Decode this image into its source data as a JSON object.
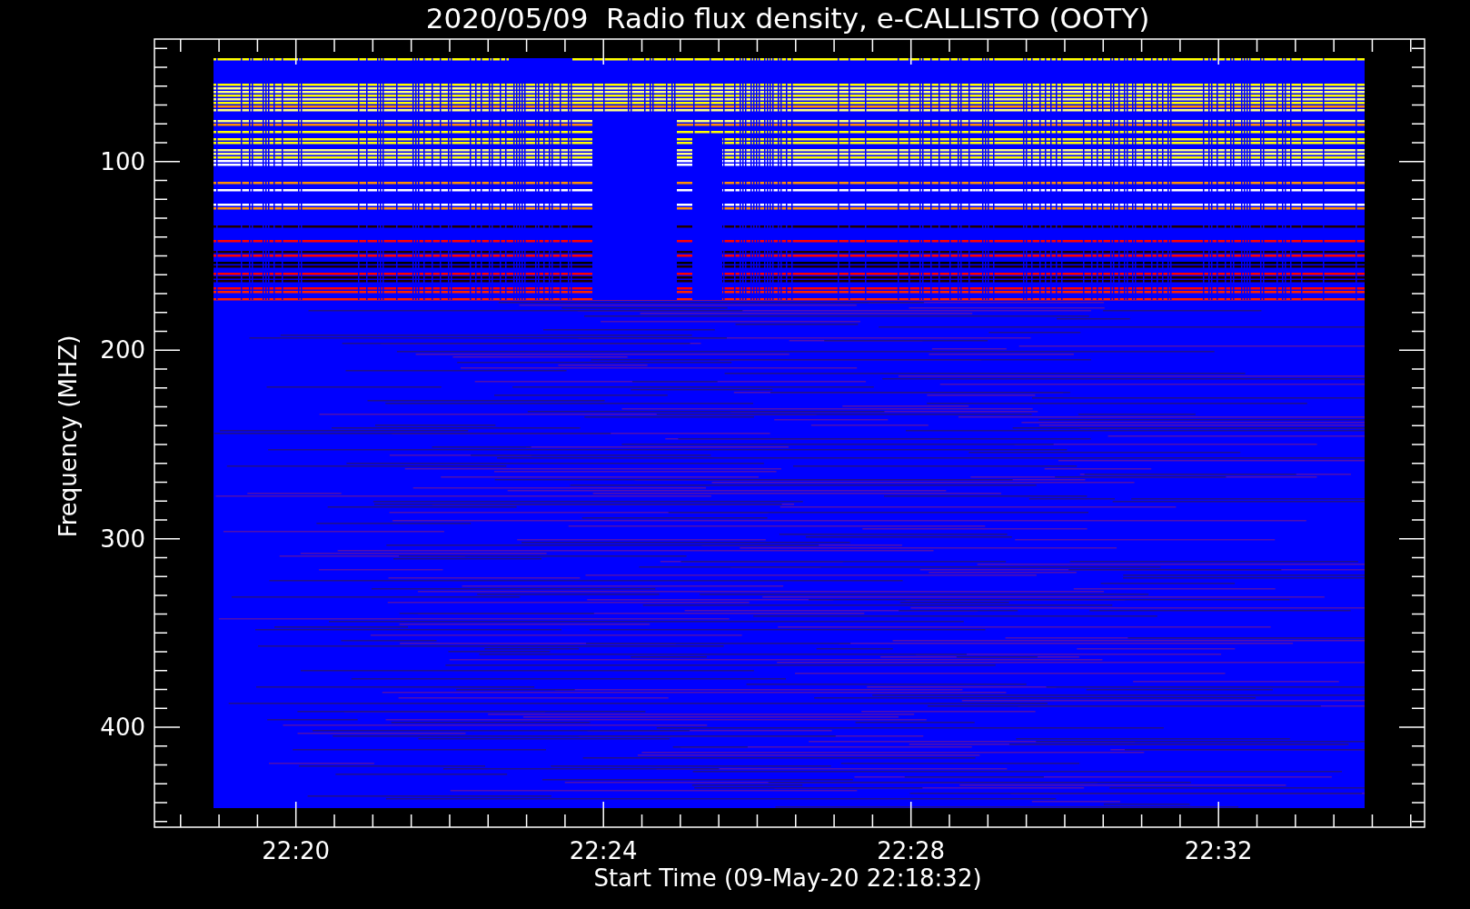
{
  "plot": {
    "title": "2020/05/09  Radio flux density, e-CALLISTO (OOTY)",
    "ylabel": "Frequency (MHZ)",
    "xlabel": "Start Time (09-May-20 22:18:32)",
    "yticks": [
      "100",
      "200",
      "300",
      "400"
    ],
    "xticks": [
      "22:20",
      "22:24",
      "22:28",
      "22:32"
    ]
  }
}
